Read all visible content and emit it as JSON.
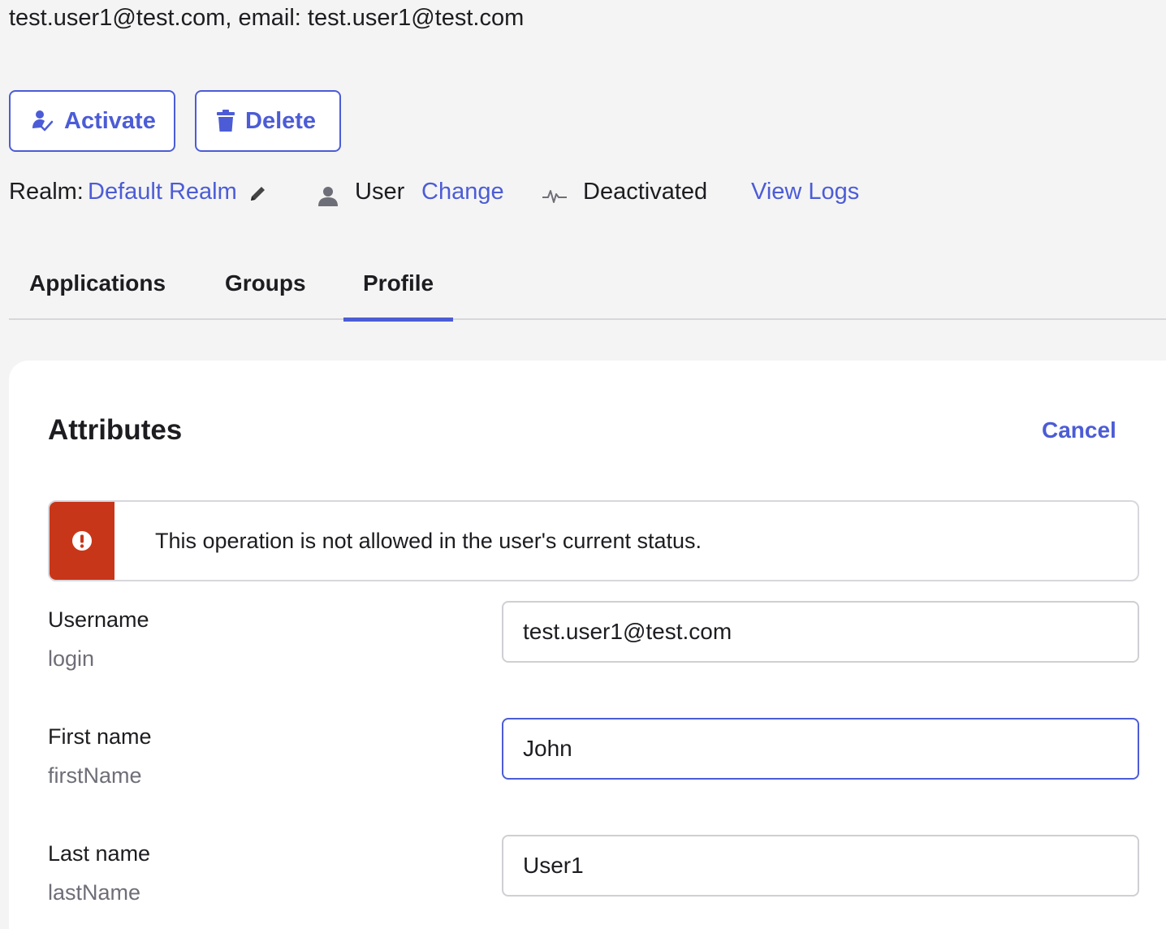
{
  "header": {
    "text": "test.user1@test.com, email: test.user1@test.com"
  },
  "actions": {
    "activate_label": "Activate",
    "delete_label": "Delete"
  },
  "meta": {
    "realm_label": "Realm:",
    "realm_value": "Default Realm",
    "user_type": "User",
    "change_label": "Change",
    "status": "Deactivated",
    "view_logs": "View Logs"
  },
  "tabs": [
    {
      "label": "Applications",
      "active": false
    },
    {
      "label": "Groups",
      "active": false
    },
    {
      "label": "Profile",
      "active": true
    }
  ],
  "card": {
    "title": "Attributes",
    "cancel_label": "Cancel"
  },
  "alert": {
    "message": "This operation is not allowed in the user's current status."
  },
  "fields": [
    {
      "label": "Username",
      "sub": "login",
      "value": "test.user1@test.com"
    },
    {
      "label": "First name",
      "sub": "firstName",
      "value": "John"
    },
    {
      "label": "Last name",
      "sub": "lastName",
      "value": "User1"
    }
  ],
  "colors": {
    "accent": "#4c5cd6",
    "error": "#c83619",
    "background": "#f4f4f4"
  },
  "icons": {
    "activate": "user-check-icon",
    "delete": "trash-icon",
    "edit": "pencil-icon",
    "user": "user-icon",
    "status": "activity-pulse-icon",
    "alert": "error-exclamation-icon"
  }
}
